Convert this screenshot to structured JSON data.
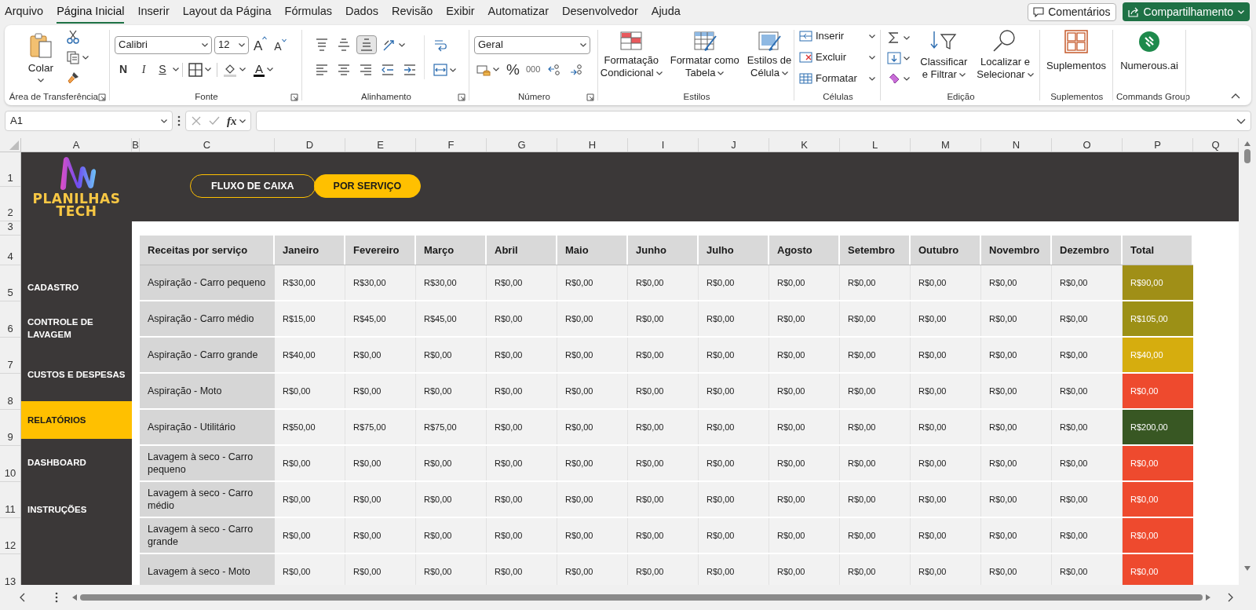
{
  "menu_tabs": [
    {
      "label": "Arquivo",
      "selected": false
    },
    {
      "label": "Página Inicial",
      "selected": true
    },
    {
      "label": "Inserir",
      "selected": false
    },
    {
      "label": "Layout da Página",
      "selected": false
    },
    {
      "label": "Fórmulas",
      "selected": false
    },
    {
      "label": "Dados",
      "selected": false
    },
    {
      "label": "Revisão",
      "selected": false
    },
    {
      "label": "Exibir",
      "selected": false
    },
    {
      "label": "Automatizar",
      "selected": false
    },
    {
      "label": "Desenvolvedor",
      "selected": false
    },
    {
      "label": "Ajuda",
      "selected": false
    }
  ],
  "comments_button": "Comentários",
  "share_button": "Compartilhamento",
  "ribbon": {
    "clipboard": {
      "paste": "Colar",
      "label": "Área de Transferência"
    },
    "font": {
      "family": "Calibri",
      "size": "12",
      "grow": "A",
      "shrink": "A",
      "bold": "N",
      "italic": "I",
      "underline": "S",
      "font_color": "A",
      "label": "Fonte"
    },
    "alignment": {
      "label": "Alinhamento"
    },
    "number": {
      "format": "Geral",
      "percent": "%",
      "thousands": "000",
      "label": "Número"
    },
    "styles": {
      "buttons": [
        {
          "lines": [
            "Formatação",
            "Condicional"
          ]
        },
        {
          "lines": [
            "Formatar como",
            "Tabela"
          ]
        },
        {
          "lines": [
            "Estilos de",
            "Célula"
          ]
        }
      ],
      "label": "Estilos"
    },
    "cells": {
      "buttons": [
        "Inserir",
        "Excluir",
        "Formatar"
      ],
      "label": "Células"
    },
    "editing": {
      "buttons": [
        {
          "lines": [
            "Classificar",
            "e Filtrar"
          ]
        },
        {
          "lines": [
            "Localizar e",
            "Selecionar"
          ]
        }
      ],
      "label": "Edição"
    },
    "addins": {
      "button": "Suplementos",
      "label": "Suplementos"
    },
    "commands": {
      "button": "Numerous.ai",
      "label": "Commands Group"
    }
  },
  "formula_bar": {
    "name_box": "A1",
    "fx": "fx"
  },
  "columns": [
    "A",
    "B",
    "C",
    "D",
    "E",
    "F",
    "G",
    "H",
    "I",
    "J",
    "K",
    "L",
    "M",
    "N",
    "O",
    "P",
    "Q"
  ],
  "rows": [
    "1",
    "2",
    "3",
    "4",
    "5",
    "6",
    "7",
    "8",
    "9",
    "10",
    "11",
    "12",
    "13"
  ],
  "sheet": {
    "logo": [
      "PLANILHAS",
      "TECH"
    ],
    "nav": [
      {
        "label": "FLUXO DE CAIXA",
        "selected": false
      },
      {
        "label": "POR SERVIÇO",
        "selected": true
      }
    ],
    "sidebar": [
      {
        "label": "CADASTRO",
        "selected": false
      },
      {
        "label": "CONTROLE DE LAVAGEM",
        "selected": false
      },
      {
        "label": "CUSTOS E DESPESAS",
        "selected": false
      },
      {
        "label": "RELATÓRIOS",
        "selected": true
      },
      {
        "label": "DASHBOARD",
        "selected": false
      },
      {
        "label": "INSTRUÇÕES",
        "selected": false
      }
    ],
    "table": {
      "columns": [
        "Receitas por serviço",
        "Janeiro",
        "Fevereiro",
        "Março",
        "Abril",
        "Maio",
        "Junho",
        "Julho",
        "Agosto",
        "Setembro",
        "Outubro",
        "Novembro",
        "Dezembro",
        "Total"
      ],
      "rows": [
        {
          "service": "Aspiração - Carro pequeno",
          "values": [
            "R$30,00",
            "R$30,00",
            "R$30,00",
            "R$0,00",
            "R$0,00",
            "R$0,00",
            "R$0,00",
            "R$0,00",
            "R$0,00",
            "R$0,00",
            "R$0,00",
            "R$0,00"
          ],
          "total": "R$90,00",
          "color": "#a08f17"
        },
        {
          "service": "Aspiração - Carro médio",
          "values": [
            "R$15,00",
            "R$45,00",
            "R$45,00",
            "R$0,00",
            "R$0,00",
            "R$0,00",
            "R$0,00",
            "R$0,00",
            "R$0,00",
            "R$0,00",
            "R$0,00",
            "R$0,00"
          ],
          "total": "R$105,00",
          "color": "#9c9016"
        },
        {
          "service": "Aspiração - Carro grande",
          "values": [
            "R$40,00",
            "R$0,00",
            "R$0,00",
            "R$0,00",
            "R$0,00",
            "R$0,00",
            "R$0,00",
            "R$0,00",
            "R$0,00",
            "R$0,00",
            "R$0,00",
            "R$0,00"
          ],
          "total": "R$40,00",
          "color": "#d6ad0e"
        },
        {
          "service": "Aspiração - Moto",
          "values": [
            "R$0,00",
            "R$0,00",
            "R$0,00",
            "R$0,00",
            "R$0,00",
            "R$0,00",
            "R$0,00",
            "R$0,00",
            "R$0,00",
            "R$0,00",
            "R$0,00",
            "R$0,00"
          ],
          "total": "R$0,00",
          "color": "#ee4a2e"
        },
        {
          "service": "Aspiração - Utilitário",
          "values": [
            "R$50,00",
            "R$75,00",
            "R$75,00",
            "R$0,00",
            "R$0,00",
            "R$0,00",
            "R$0,00",
            "R$0,00",
            "R$0,00",
            "R$0,00",
            "R$0,00",
            "R$0,00"
          ],
          "total": "R$200,00",
          "color": "#385723"
        },
        {
          "service": "Lavagem à seco - Carro pequeno",
          "values": [
            "R$0,00",
            "R$0,00",
            "R$0,00",
            "R$0,00",
            "R$0,00",
            "R$0,00",
            "R$0,00",
            "R$0,00",
            "R$0,00",
            "R$0,00",
            "R$0,00",
            "R$0,00"
          ],
          "total": "R$0,00",
          "color": "#ee4a2e"
        },
        {
          "service": "Lavagem à seco - Carro médio",
          "values": [
            "R$0,00",
            "R$0,00",
            "R$0,00",
            "R$0,00",
            "R$0,00",
            "R$0,00",
            "R$0,00",
            "R$0,00",
            "R$0,00",
            "R$0,00",
            "R$0,00",
            "R$0,00"
          ],
          "total": "R$0,00",
          "color": "#ee4a2e"
        },
        {
          "service": "Lavagem à seco - Carro grande",
          "values": [
            "R$0,00",
            "R$0,00",
            "R$0,00",
            "R$0,00",
            "R$0,00",
            "R$0,00",
            "R$0,00",
            "R$0,00",
            "R$0,00",
            "R$0,00",
            "R$0,00",
            "R$0,00"
          ],
          "total": "R$0,00",
          "color": "#ee4a2e"
        },
        {
          "service": "Lavagem à seco - Moto",
          "values": [
            "R$0,00",
            "R$0,00",
            "R$0,00",
            "R$0,00",
            "R$0,00",
            "R$0,00",
            "R$0,00",
            "R$0,00",
            "R$0,00",
            "R$0,00",
            "R$0,00",
            "R$0,00"
          ],
          "total": "R$0,00",
          "color": "#ee4a2e"
        }
      ]
    }
  }
}
